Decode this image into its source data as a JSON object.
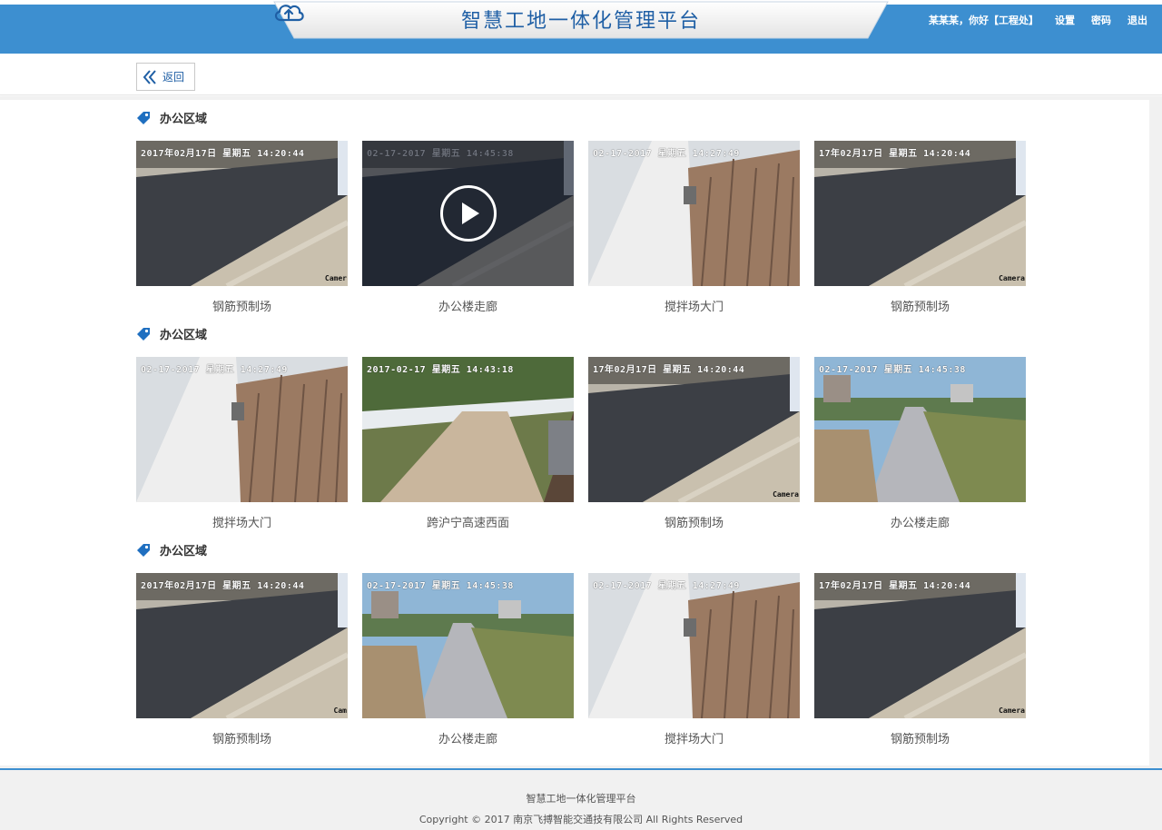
{
  "header": {
    "title": "智慧工地一体化管理平台",
    "greeting": "某某某，你好【工程处】",
    "settings": "设置",
    "password": "密码",
    "logout": "退出"
  },
  "toolbar": {
    "back_label": "返回"
  },
  "sections": [
    {
      "title": "办公区域",
      "videos": [
        {
          "caption": "钢筋预制场",
          "timestamp": "2017年02月17日 星期五 14:20:44",
          "cam": "Camer",
          "playing": false
        },
        {
          "caption": "办公楼走廊",
          "timestamp": "02-17-2017 星期五 14:45:38",
          "cam": "",
          "playing": true
        },
        {
          "caption": "搅拌场大门",
          "timestamp": "02-17-2017 星期五 14:27:49",
          "cam": "",
          "playing": false
        },
        {
          "caption": "钢筋预制场",
          "timestamp": "17年02月17日 星期五 14:20:44",
          "cam": "Camera",
          "playing": false
        }
      ]
    },
    {
      "title": "办公区域",
      "videos": [
        {
          "caption": "搅拌场大门",
          "timestamp": "02-17-2017 星期五 14:27:49",
          "cam": "",
          "playing": false
        },
        {
          "caption": "跨沪宁高速西面",
          "timestamp": "2017-02-17 星期五 14:43:18",
          "cam": "",
          "playing": false
        },
        {
          "caption": "钢筋预制场",
          "timestamp": "17年02月17日 星期五 14:20:44",
          "cam": "Camera",
          "playing": false
        },
        {
          "caption": "办公楼走廊",
          "timestamp": "02-17-2017 星期五 14:45:38",
          "cam": "",
          "playing": false
        }
      ]
    },
    {
      "title": "办公区域",
      "videos": [
        {
          "caption": "钢筋预制场",
          "timestamp": "2017年02月17日 星期五 14:20:44",
          "cam": "Cam",
          "playing": false
        },
        {
          "caption": "办公楼走廊",
          "timestamp": "02-17-2017 星期五 14:45:38",
          "cam": "",
          "playing": false
        },
        {
          "caption": "搅拌场大门",
          "timestamp": "02-17-2017 星期五 14:27:49",
          "cam": "",
          "playing": false
        },
        {
          "caption": "钢筋预制场",
          "timestamp": "17年02月17日 星期五 14:20:44",
          "cam": "Camera",
          "playing": false
        }
      ]
    }
  ],
  "footer": {
    "line1": "智慧工地一体化管理平台",
    "line2": "Copyright © 2017 南京飞搏智能交通技有限公司 All Rights Reserved"
  },
  "colors": {
    "brand_blue": "#3d8fd0",
    "title_blue": "#1f5fa5"
  },
  "icons": {
    "title": "cloud-upload-icon",
    "back": "double-chevron-left-icon",
    "section": "tag-icon",
    "play": "play-icon"
  }
}
